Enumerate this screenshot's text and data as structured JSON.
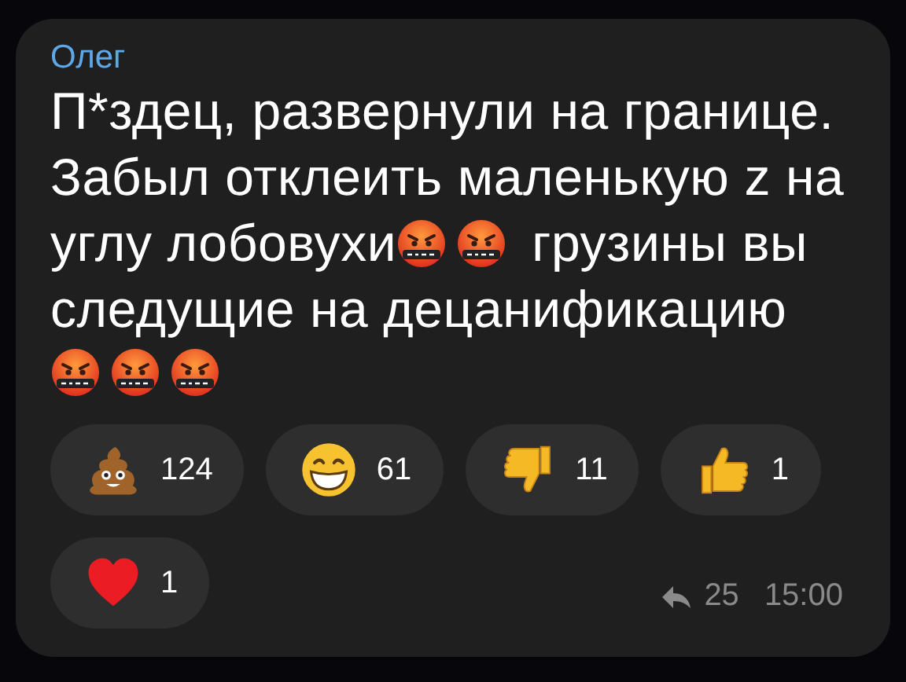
{
  "sender": "Олег",
  "message_lines": [
    [
      {
        "kind": "text",
        "text": "П*здец, развернули на границе."
      }
    ],
    [
      {
        "kind": "text",
        "text": "Забыл отклеить маленькую z на"
      }
    ],
    [
      {
        "kind": "text",
        "text": "углу лобовухи"
      },
      {
        "kind": "emoji"
      },
      {
        "kind": "emoji"
      },
      {
        "kind": "text",
        "text": "грузины вы"
      }
    ],
    [
      {
        "kind": "text",
        "text": "следущие на децанификацию"
      }
    ],
    [
      {
        "kind": "emoji"
      },
      {
        "kind": "emoji"
      },
      {
        "kind": "emoji"
      }
    ]
  ],
  "reactions": [
    {
      "kind": "poop",
      "count": "124"
    },
    {
      "kind": "grin",
      "count": "61"
    },
    {
      "kind": "thumbs_down",
      "count": "11"
    },
    {
      "kind": "thumbs_up",
      "count": "1"
    },
    {
      "kind": "heart",
      "count": "1"
    }
  ],
  "shares": "25",
  "time": "15:00"
}
